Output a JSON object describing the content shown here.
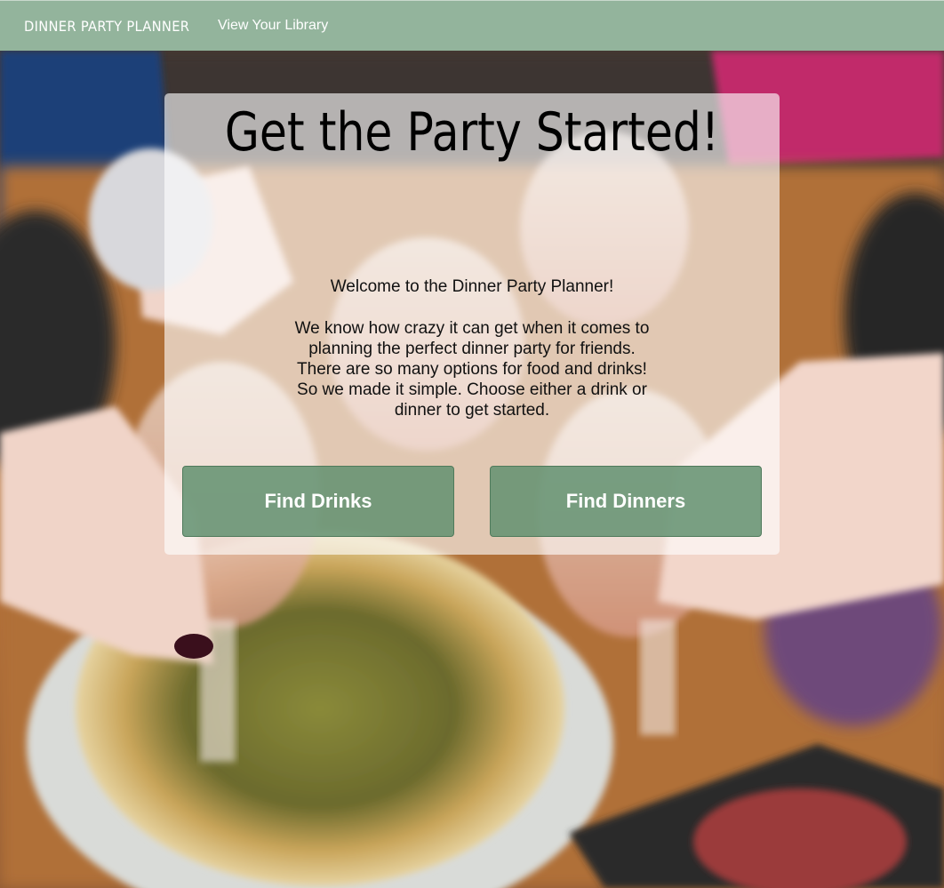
{
  "nav": {
    "brand": "DINNER PARTY PLANNER",
    "library_link": "View Your Library"
  },
  "hero": {
    "title": "Get the Party Started!",
    "welcome": "Welcome to the Dinner Party Planner!",
    "intro": "We know how crazy it can get when it comes to planning the perfect dinner party for friends. There are so many options for food and drinks! So we made it simple. Choose either a drink or dinner to get started.",
    "find_drinks_label": "Find Drinks",
    "find_dinners_label": "Find Dinners"
  },
  "colors": {
    "navbar": "#93b49c",
    "button": "#629170",
    "card": "rgba(255,255,255,0.62)"
  }
}
